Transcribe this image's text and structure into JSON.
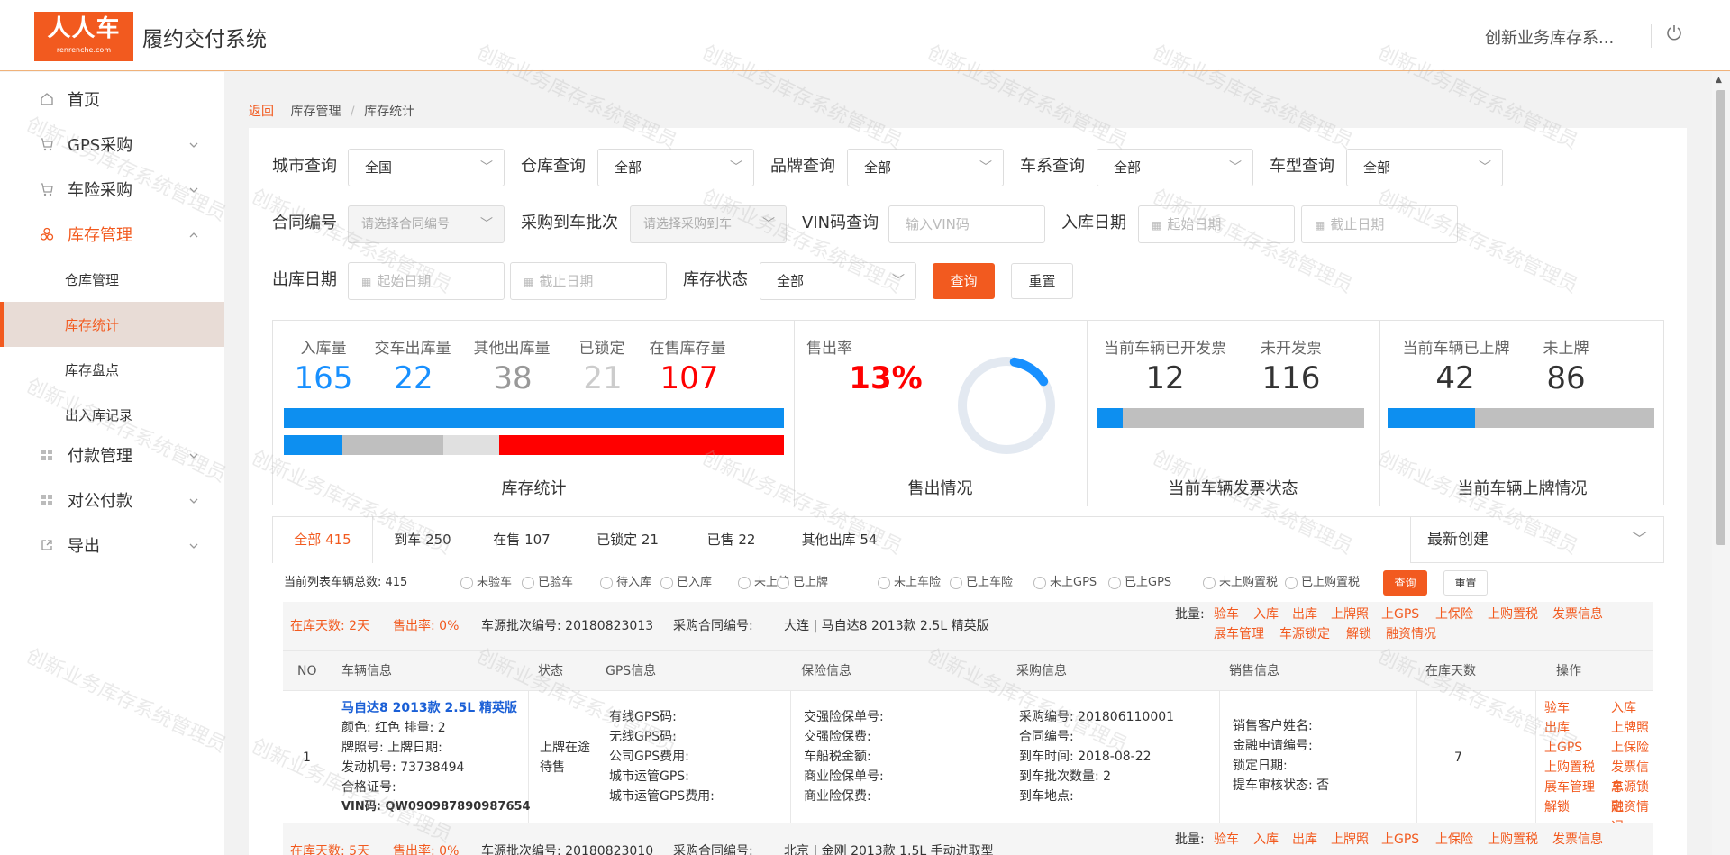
{
  "header": {
    "logo_text": "人人车",
    "logo_sub": "renrenche.com",
    "app_title": "履约交付系统",
    "user_name": "创新业务库存系...",
    "power_icon": "power-icon"
  },
  "sidebar": {
    "items": [
      {
        "label": "首页",
        "icon": "home-icon"
      },
      {
        "label": "GPS采购",
        "icon": "cart-icon"
      },
      {
        "label": "车险采购",
        "icon": "cart-icon"
      },
      {
        "label": "库存管理",
        "icon": "cluster-icon"
      },
      {
        "label": "付款管理",
        "icon": "grid-icon"
      },
      {
        "label": "对公付款",
        "icon": "grid-icon"
      },
      {
        "label": "导出",
        "icon": "export-icon"
      }
    ],
    "sub_items": [
      "仓库管理",
      "库存统计",
      "库存盘点",
      "出入库记录"
    ]
  },
  "breadcrumb": {
    "back": "返回",
    "level1": "库存管理",
    "sep": "/",
    "level2": "库存统计"
  },
  "filters": {
    "city": {
      "label": "城市查询",
      "value": "全国"
    },
    "warehouse": {
      "label": "仓库查询",
      "value": "全部"
    },
    "brand": {
      "label": "品牌查询",
      "value": "全部"
    },
    "series": {
      "label": "车系查询",
      "value": "全部"
    },
    "model": {
      "label": "车型查询",
      "value": "全部"
    },
    "contract": {
      "label": "合同编号",
      "placeholder": "请选择合同编号"
    },
    "purchase_batch": {
      "label": "采购到车批次",
      "placeholder": "请选择采购到车"
    },
    "vin": {
      "label": "VIN码查询",
      "placeholder": "输入VIN码"
    },
    "in_date": {
      "label": "入库日期",
      "start": "起始日期",
      "end": "截止日期"
    },
    "out_date": {
      "label": "出库日期",
      "start": "起始日期",
      "end": "截止日期"
    },
    "status": {
      "label": "库存状态",
      "value": "全部"
    },
    "query_btn": "查询",
    "reset_btn": "重置"
  },
  "stats": {
    "inventory": {
      "title": "库存统计",
      "items": [
        {
          "label": "入库量",
          "value": "165",
          "color": "#1890ff"
        },
        {
          "label": "交车出库量",
          "value": "22",
          "color": "#1890ff"
        },
        {
          "label": "其他出库量",
          "value": "38",
          "color": "#999999"
        },
        {
          "label": "已锁定",
          "value": "21",
          "color": "#cccccc"
        },
        {
          "label": "在售库存量",
          "value": "107",
          "color": "#ff0000"
        }
      ]
    },
    "sales": {
      "title": "售出情况",
      "label": "售出率",
      "value": "13%",
      "rate": 0.13
    },
    "invoice": {
      "title": "当前车辆发票状态",
      "items": [
        {
          "label": "当前车辆已开发票",
          "value": "12"
        },
        {
          "label": "未开发票",
          "value": "116"
        }
      ]
    },
    "plate": {
      "title": "当前车辆上牌情况",
      "items": [
        {
          "label": "当前车辆已上牌",
          "value": "42"
        },
        {
          "label": "未上牌",
          "value": "86"
        }
      ]
    }
  },
  "tabs": [
    {
      "label": "全部 415"
    },
    {
      "label": "到车 250"
    },
    {
      "label": "在售 107"
    },
    {
      "label": "已锁定 21"
    },
    {
      "label": "已售 22"
    },
    {
      "label": "其他出库 54"
    }
  ],
  "sort": {
    "value": "最新创建"
  },
  "list_filter": {
    "total_label": "当前列表车辆总数:  415",
    "radios": [
      "未验车",
      "已验车",
      "待入库",
      "已入库",
      "未上牌",
      "已上牌",
      "未上车险",
      "已上车险",
      "未上GPS",
      "已上GPS",
      "未上购置税",
      "已上购置税"
    ],
    "query_btn": "查询",
    "reset_btn": "重置"
  },
  "batch1": {
    "days": "在库天数:  2天",
    "rate": "售出率:  0%",
    "batch_no": "车源批次编号:  20180823013",
    "contract": "采购合同编号:",
    "vehicle": "大连 | 马自达8 2013款 2.5L 精英版",
    "batch_label": "批量:",
    "actions_line1": [
      "验车",
      "入库",
      "出库",
      "上牌照",
      "上GPS",
      "上保险",
      "上购置税",
      "发票信息"
    ],
    "actions_line2": [
      "展车管理",
      "车源锁定",
      "解锁",
      "融资情况"
    ]
  },
  "table": {
    "headers": [
      "NO",
      "车辆信息",
      "状态",
      "GPS信息",
      "保险信息",
      "采购信息",
      "销售信息",
      "在库天数",
      "操作"
    ],
    "row": {
      "no": "1",
      "vehicle_title": "马自达8 2013款 2.5L 精英版",
      "vehicle_lines": [
        "颜色:  红色    排量:  2",
        "牌照号:      上牌日期:",
        "发动机号:  73738494",
        "合格证号:",
        "VIN码:  QW090987890987654"
      ],
      "status": [
        "上牌在途",
        "待售"
      ],
      "gps": [
        "有线GPS码:",
        "无线GPS码:",
        "公司GPS费用:",
        "城市运管GPS:",
        "城市运管GPS费用:"
      ],
      "insurance": [
        "交强险保单号:",
        "交强险保费:",
        "车船税金额:",
        "商业险保单号:",
        "商业险保费:"
      ],
      "purchase": [
        "采购编号:  201806110001",
        "合同编号:",
        "到车时间:  2018-08-22",
        "到车批次数量:  2",
        "到车地点:"
      ],
      "sales": [
        "销售客户姓名:",
        "金融申请编号:",
        "锁定日期:",
        "提车审核状态:  否"
      ],
      "days": "7",
      "ops": [
        "验车",
        "入库",
        "出库",
        "上牌照",
        "上GPS",
        "上保险",
        "上购置税",
        "发票信息",
        "展车管理",
        "车源锁定",
        "解锁",
        "融资情况"
      ]
    }
  },
  "batch2": {
    "days": "在库天数:  5天",
    "rate": "售出率:  0%",
    "batch_no": "车源批次编号:  20180823010",
    "contract": "采购合同编号:",
    "vehicle": "北京 | 金刚 2013款 1.5L 手动进取型",
    "batch_label": "批量:",
    "actions_line1": [
      "验车",
      "入库",
      "出库",
      "上牌照",
      "上GPS",
      "上保险",
      "上购置税",
      "发票信息"
    ]
  },
  "watermark": "创新业务库存系统管理员"
}
